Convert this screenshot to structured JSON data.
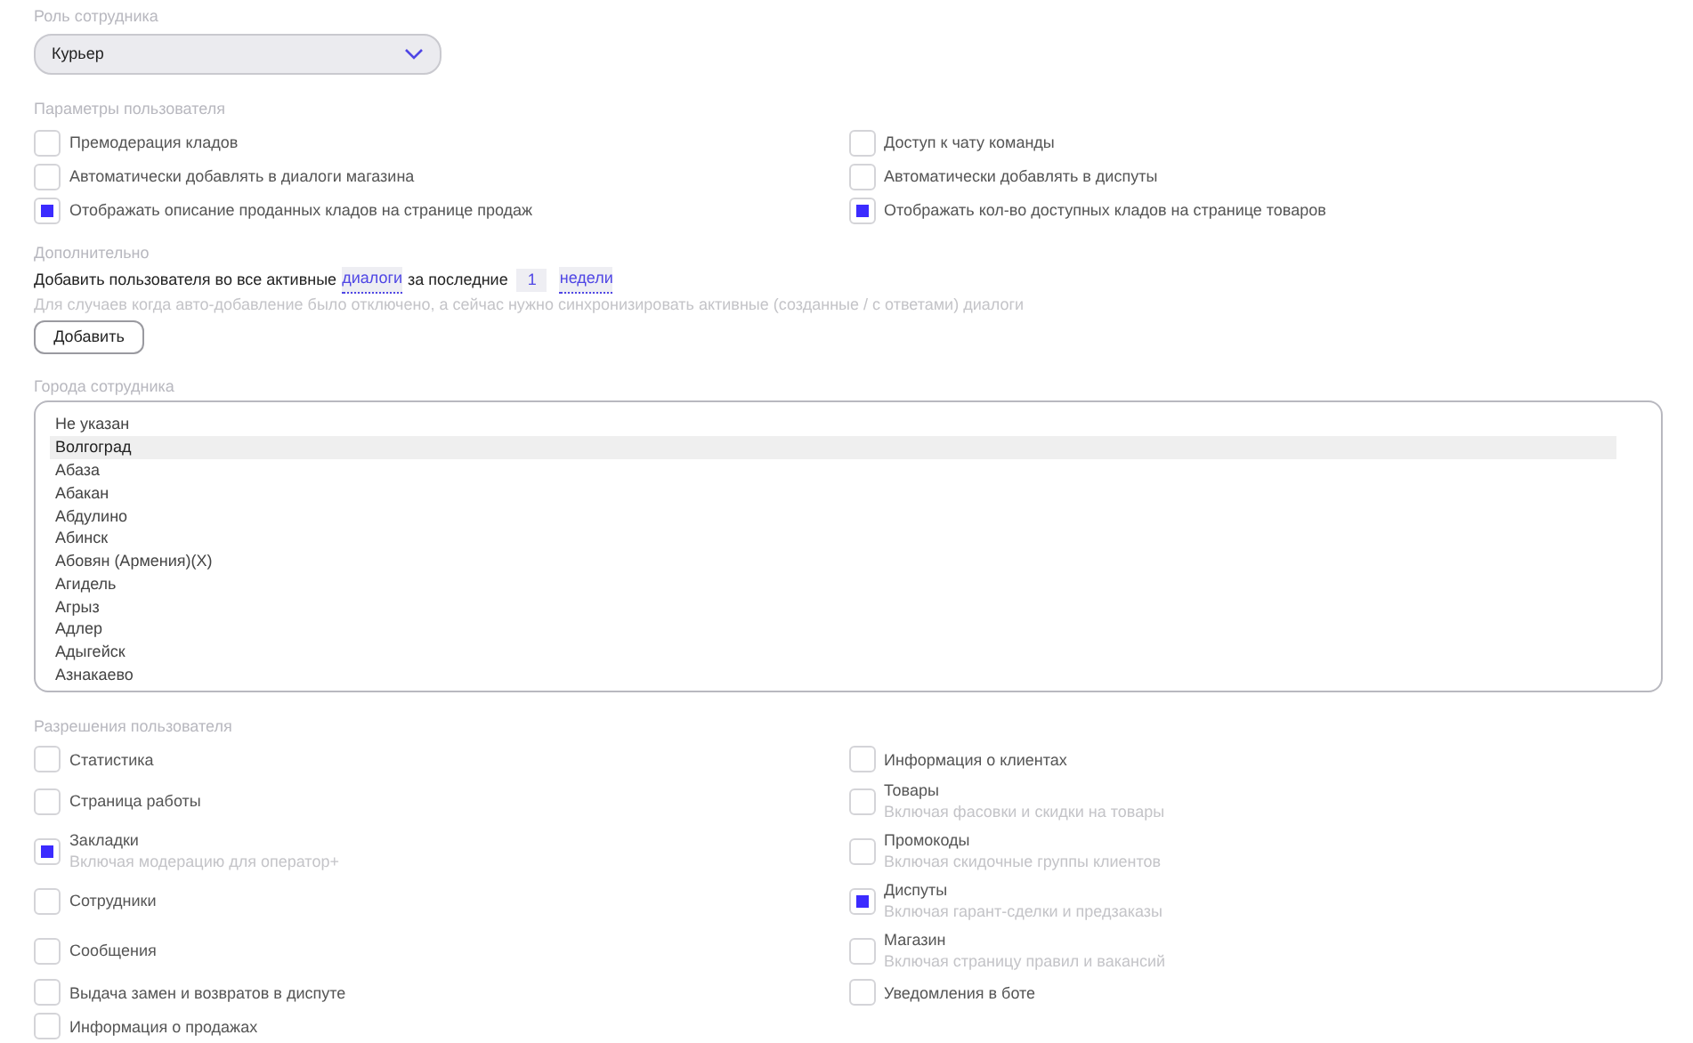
{
  "role": {
    "label": "Роль сотрудника",
    "value": "Курьер"
  },
  "params": {
    "label": "Параметры пользователя",
    "left": [
      {
        "label": "Премодерация кладов",
        "checked": false
      },
      {
        "label": "Автоматически добавлять в диалоги магазина",
        "checked": false
      },
      {
        "label": "Отображать описание проданных кладов на странице продаж",
        "checked": true
      }
    ],
    "right": [
      {
        "label": "Доступ к чату команды",
        "checked": false
      },
      {
        "label": "Автоматически добавлять в диспуты",
        "checked": false
      },
      {
        "label": "Отображать кол-во доступных кладов на странице товаров",
        "checked": true
      }
    ]
  },
  "extra": {
    "label": "Дополнительно",
    "text_before": "Добавить пользователя во все активные",
    "dialog_type": "диалоги",
    "text_middle": "за последние",
    "count": "1",
    "period": "недели",
    "hint": "Для случаев когда авто-добавление было отключено, а сейчас нужно синхронизировать активные (созданные / с ответами) диалоги",
    "button": "Добавить"
  },
  "cities": {
    "label": "Города сотрудника",
    "items": [
      {
        "name": "Не указан",
        "selected": false
      },
      {
        "name": "Волгоград",
        "selected": true
      },
      {
        "name": "Абаза",
        "selected": false
      },
      {
        "name": "Абакан",
        "selected": false
      },
      {
        "name": "Абдулино",
        "selected": false
      },
      {
        "name": "Абинск",
        "selected": false
      },
      {
        "name": "Абовян (Армения)(X)",
        "selected": false
      },
      {
        "name": "Агидель",
        "selected": false
      },
      {
        "name": "Агрыз",
        "selected": false
      },
      {
        "name": "Адлер",
        "selected": false
      },
      {
        "name": "Адыгейск",
        "selected": false
      },
      {
        "name": "Азнакаево",
        "selected": false
      }
    ]
  },
  "permissions": {
    "label": "Разрешения пользователя",
    "left": [
      {
        "label": "Статистика",
        "checked": false
      },
      {
        "label": "Страница работы",
        "checked": false
      },
      {
        "label": "Закладки",
        "note": "Включая модерацию для оператор+",
        "checked": true
      },
      {
        "label": "Сотрудники",
        "checked": false
      },
      {
        "label": "Сообщения",
        "checked": false
      },
      {
        "label": "Выдача замен и возвратов в диспуте",
        "checked": false
      },
      {
        "label": "Информация о продажах",
        "checked": false
      }
    ],
    "right": [
      {
        "label": "Информация о клиентах",
        "checked": false
      },
      {
        "label": "Товары",
        "note": "Включая фасовки и скидки на товары",
        "checked": false
      },
      {
        "label": "Промокоды",
        "note": "Включая скидочные группы клиентов",
        "checked": false
      },
      {
        "label": "Диспуты",
        "note": "Включая гарант-сделки и предзаказы",
        "checked": true
      },
      {
        "label": "Магазин",
        "note": "Включая страницу правил и вакансий",
        "checked": false
      },
      {
        "label": "Уведомления в боте",
        "checked": false
      }
    ]
  }
}
